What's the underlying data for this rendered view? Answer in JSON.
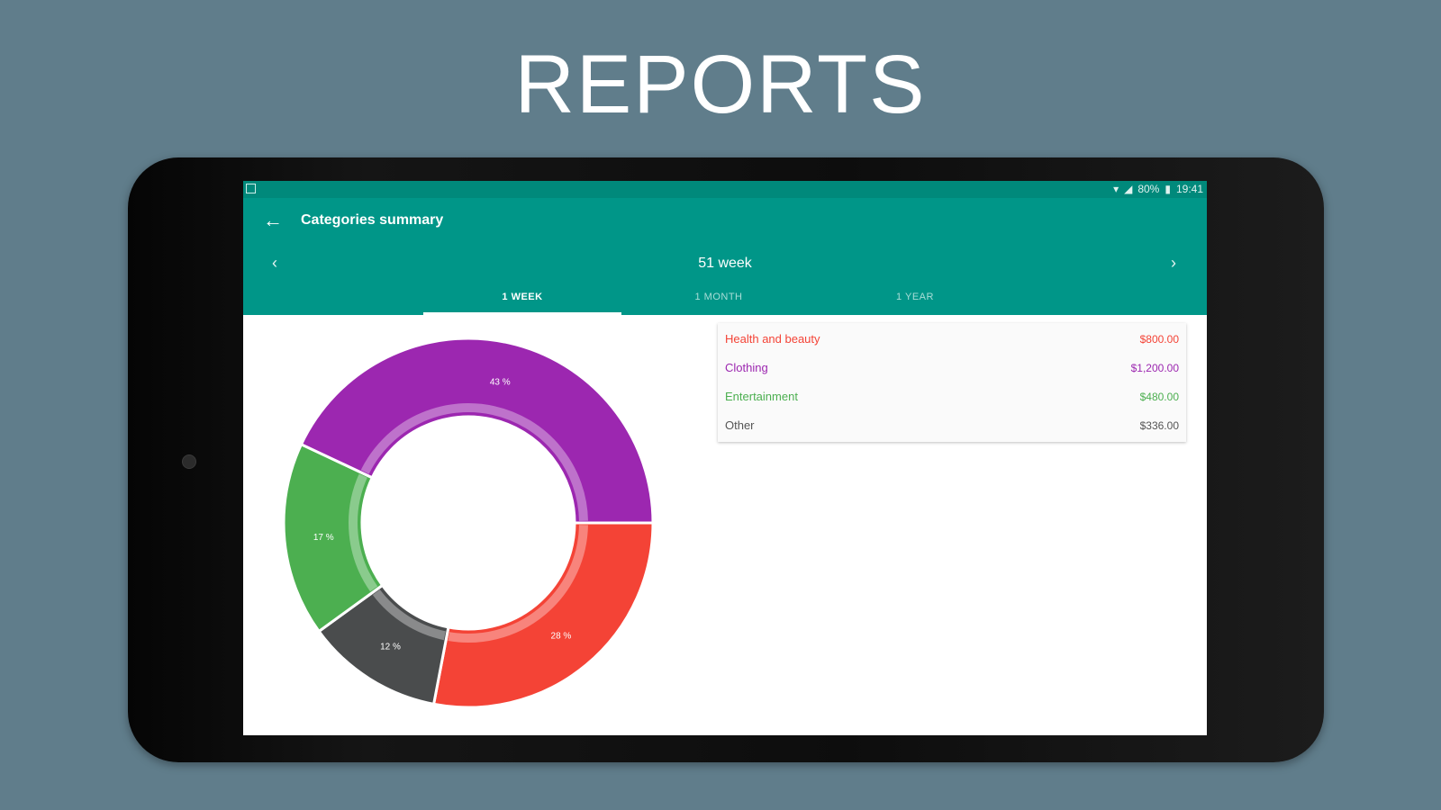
{
  "headline": "REPORTS",
  "status_bar": {
    "battery": "80%",
    "time": "19:41"
  },
  "app_bar": {
    "title": "Categories summary"
  },
  "period": {
    "label": "51 week"
  },
  "tabs": [
    {
      "label": "1 WEEK",
      "active": true
    },
    {
      "label": "1 MONTH",
      "active": false
    },
    {
      "label": "1 YEAR",
      "active": false
    }
  ],
  "legend": [
    {
      "name": "Health and beauty",
      "amount": "$800.00",
      "color": "#f44336"
    },
    {
      "name": "Clothing",
      "amount": "$1,200.00",
      "color": "#9c27b0"
    },
    {
      "name": "Entertainment",
      "amount": "$480.00",
      "color": "#4caf50"
    },
    {
      "name": "Other",
      "amount": "$336.00",
      "color": "#555555"
    }
  ],
  "chart_data": {
    "type": "pie",
    "categories": [
      "Health and beauty",
      "Other",
      "Entertainment",
      "Clothing"
    ],
    "values": [
      28,
      12,
      17,
      43
    ],
    "labels": [
      "28 %",
      "12 %",
      "17 %",
      "43 %"
    ],
    "colors": [
      "#f44336",
      "#4a4c4d",
      "#4caf50",
      "#9c27b0"
    ],
    "donut": true
  }
}
